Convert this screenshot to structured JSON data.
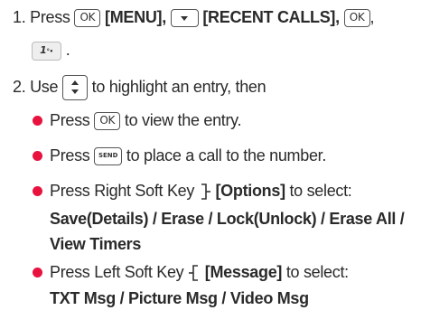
{
  "step1": {
    "number": "1.",
    "menu_label": "[MENU],",
    "recent_calls_label": "[RECENT CALLS],",
    "trailing_comma": ",",
    "end_period": "."
  },
  "step2": {
    "number": "2. Use",
    "text": "to highlight an entry, then"
  },
  "keys": {
    "ok": "OK",
    "send": "SEND",
    "one": "1",
    "one_sub": "°•"
  },
  "bullets": [
    {
      "pre": "Press",
      "post": "to view the entry."
    },
    {
      "pre": "Press",
      "post": "to place a call to the number."
    },
    {
      "pre": "Press Right Soft Key",
      "label": "[Options]",
      "post": "to select:",
      "line2": "Save(Details) / Erase / Lock(Unlock) / Erase All /",
      "line3": "View Timers"
    },
    {
      "pre": "Press Left Soft Key",
      "label": "[Message]",
      "post": "to select:",
      "line2": "TXT Msg / Picture Msg / Video Msg"
    }
  ],
  "colors": {
    "bullet": "#e8123f",
    "text": "#2a2a2a"
  }
}
